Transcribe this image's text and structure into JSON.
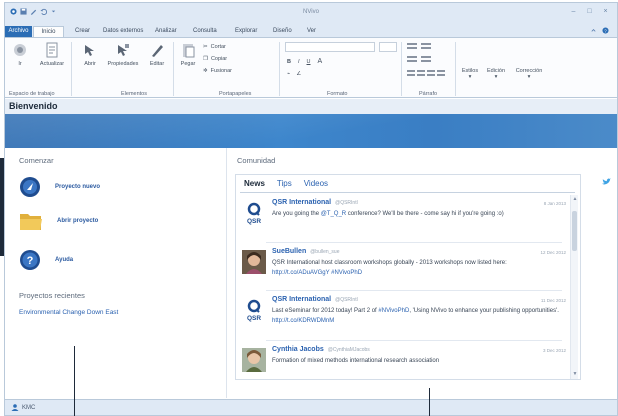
{
  "app": {
    "title": "NVivo"
  },
  "ribbon": {
    "tabs": [
      "Archivo",
      "Inicio",
      "Crear",
      "Datos externos",
      "Analizar",
      "Consulta",
      "Explorar",
      "Diseño",
      "Ver"
    ],
    "groups": {
      "workspace": {
        "label": "Espacio de trabajo",
        "buttons": [
          "Ir",
          "Actualizar"
        ]
      },
      "items": {
        "label": "Elementos",
        "buttons": [
          "Abrir",
          "Propiedades",
          "Editar"
        ]
      },
      "clipboard": {
        "label": "Portapapeles",
        "paste": "Pegar",
        "cut": "Cortar",
        "copy": "Copiar",
        "merge": "Fusionar"
      },
      "format": {
        "label": "Formato",
        "bold": "B",
        "italic": "I",
        "underline": "U",
        "font_color": "A"
      },
      "paragraph": {
        "label": "Párrafo"
      },
      "styles": {
        "buttons": [
          "Estilos",
          "Edición",
          "Corrección"
        ]
      }
    }
  },
  "page": {
    "title": "Bienvenido"
  },
  "start": {
    "title": "Comenzar",
    "items": [
      {
        "label": "Proyecto nuevo",
        "icon": "new-project-icon"
      },
      {
        "label": "Abrir proyecto",
        "icon": "folder-icon"
      },
      {
        "label": "Ayuda",
        "icon": "help-icon"
      }
    ],
    "recent_title": "Proyectos recientes",
    "recent": [
      "Environmental Change Down East"
    ]
  },
  "community": {
    "title": "Comunidad",
    "tabs": [
      "News",
      "Tips",
      "Videos"
    ],
    "active_tab": "News",
    "posts": [
      {
        "name": "QSR International",
        "handle": "@QSRIntl",
        "date": "8 Jan 2013",
        "text_before": "Are you going the ",
        "link": "@T_Q_R",
        "text_after": " conference? We'll be there - come say hi if you're going :o)",
        "avatar": "qsr-logo"
      },
      {
        "name": "SueBullen",
        "handle": "@bullen_sue",
        "date": "12 Dec 2012",
        "text_before": "QSR International host classroom workshops globally - 2013 workshops now listed here: ",
        "link": "http://t.co/ADuAVGgY #NVivoPhD",
        "text_after": "",
        "avatar": "user-photo"
      },
      {
        "name": "QSR International",
        "handle": "@QSRIntl",
        "date": "11 Dec 2012",
        "text_before": "Last eSeminar for 2012 today! Part 2 of ",
        "link": "#NVivoPhD",
        "text_after": ", 'Using NVivo to enhance your publishing opportunities'. ",
        "link2": "http://t.co/KDRWDMnM",
        "avatar": "qsr-logo"
      },
      {
        "name": "Cynthia Jacobs",
        "handle": "@CynthiaMJacobs",
        "date": "3 Dec 2012",
        "text_before": "Formation of mixed methods international research association",
        "link": "",
        "text_after": "",
        "avatar": "user-photo"
      }
    ]
  },
  "status": {
    "user": "KMC"
  },
  "colors": {
    "accent": "#2b6db5",
    "link": "#2b62b0",
    "banner": "#3d86cc"
  }
}
